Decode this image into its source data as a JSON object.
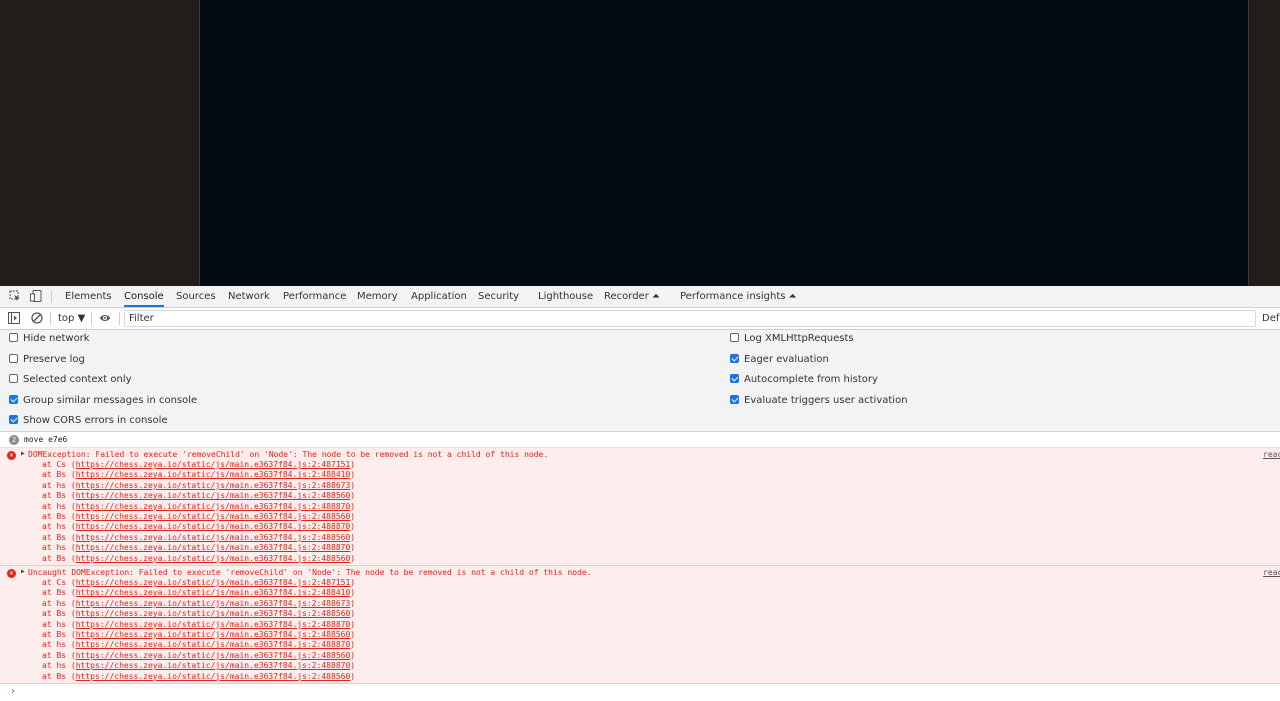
{
  "devtools": {
    "tabs": [
      "Elements",
      "Console",
      "Sources",
      "Network",
      "Performance",
      "Memory",
      "Application",
      "Security",
      "Lighthouse",
      "Recorder ⏶",
      "Performance insights ⏶"
    ],
    "active_tab": "Console",
    "toolbar": {
      "context": "top ▼",
      "filter_placeholder": "Filter",
      "levels": "Def"
    },
    "settings_left": [
      "Hide network",
      "Preserve log",
      "Selected context only",
      "Group similar messages in console",
      "Show CORS errors in console"
    ],
    "settings_left_checked": [
      false,
      false,
      false,
      true,
      true
    ],
    "settings_right": [
      "Log XMLHttpRequests",
      "Eager evaluation",
      "Autocomplete from history",
      "Evaluate triggers user activation"
    ],
    "settings_right_checked": [
      false,
      true,
      true,
      true
    ]
  },
  "console": {
    "log": {
      "count": "2",
      "text": "move e7e6"
    },
    "errors": [
      {
        "headline": "DOMException: Failed to execute 'removeChild' on 'Node': The node to be removed is not a child of this node.",
        "source": "reac",
        "frames": [
          [
            "Cs",
            "https://chess.zeya.io/static/js/main.e3637f84.js:2:487151"
          ],
          [
            "Bs",
            "https://chess.zeya.io/static/js/main.e3637f84.js:2:488410"
          ],
          [
            "hs",
            "https://chess.zeya.io/static/js/main.e3637f84.js:2:488673"
          ],
          [
            "Bs",
            "https://chess.zeya.io/static/js/main.e3637f84.js:2:488560"
          ],
          [
            "hs",
            "https://chess.zeya.io/static/js/main.e3637f84.js:2:488870"
          ],
          [
            "Bs",
            "https://chess.zeya.io/static/js/main.e3637f84.js:2:488560"
          ],
          [
            "hs",
            "https://chess.zeya.io/static/js/main.e3637f84.js:2:488870"
          ],
          [
            "Bs",
            "https://chess.zeya.io/static/js/main.e3637f84.js:2:488560"
          ],
          [
            "hs",
            "https://chess.zeya.io/static/js/main.e3637f84.js:2:488870"
          ],
          [
            "Bs",
            "https://chess.zeya.io/static/js/main.e3637f84.js:2:488560"
          ]
        ]
      },
      {
        "headline": "Uncaught DOMException: Failed to execute 'removeChild' on 'Node': The node to be removed is not a child of this node.",
        "source": "reac",
        "frames": [
          [
            "Cs",
            "https://chess.zeya.io/static/js/main.e3637f84.js:2:487151"
          ],
          [
            "Bs",
            "https://chess.zeya.io/static/js/main.e3637f84.js:2:488410"
          ],
          [
            "hs",
            "https://chess.zeya.io/static/js/main.e3637f84.js:2:488673"
          ],
          [
            "Bs",
            "https://chess.zeya.io/static/js/main.e3637f84.js:2:488560"
          ],
          [
            "hs",
            "https://chess.zeya.io/static/js/main.e3637f84.js:2:488870"
          ],
          [
            "Bs",
            "https://chess.zeya.io/static/js/main.e3637f84.js:2:488560"
          ],
          [
            "hs",
            "https://chess.zeya.io/static/js/main.e3637f84.js:2:488870"
          ],
          [
            "Bs",
            "https://chess.zeya.io/static/js/main.e3637f84.js:2:488560"
          ],
          [
            "hs",
            "https://chess.zeya.io/static/js/main.e3637f84.js:2:488870"
          ],
          [
            "Bs",
            "https://chess.zeya.io/static/js/main.e3637f84.js:2:488560"
          ]
        ]
      }
    ],
    "prompt": "›"
  }
}
